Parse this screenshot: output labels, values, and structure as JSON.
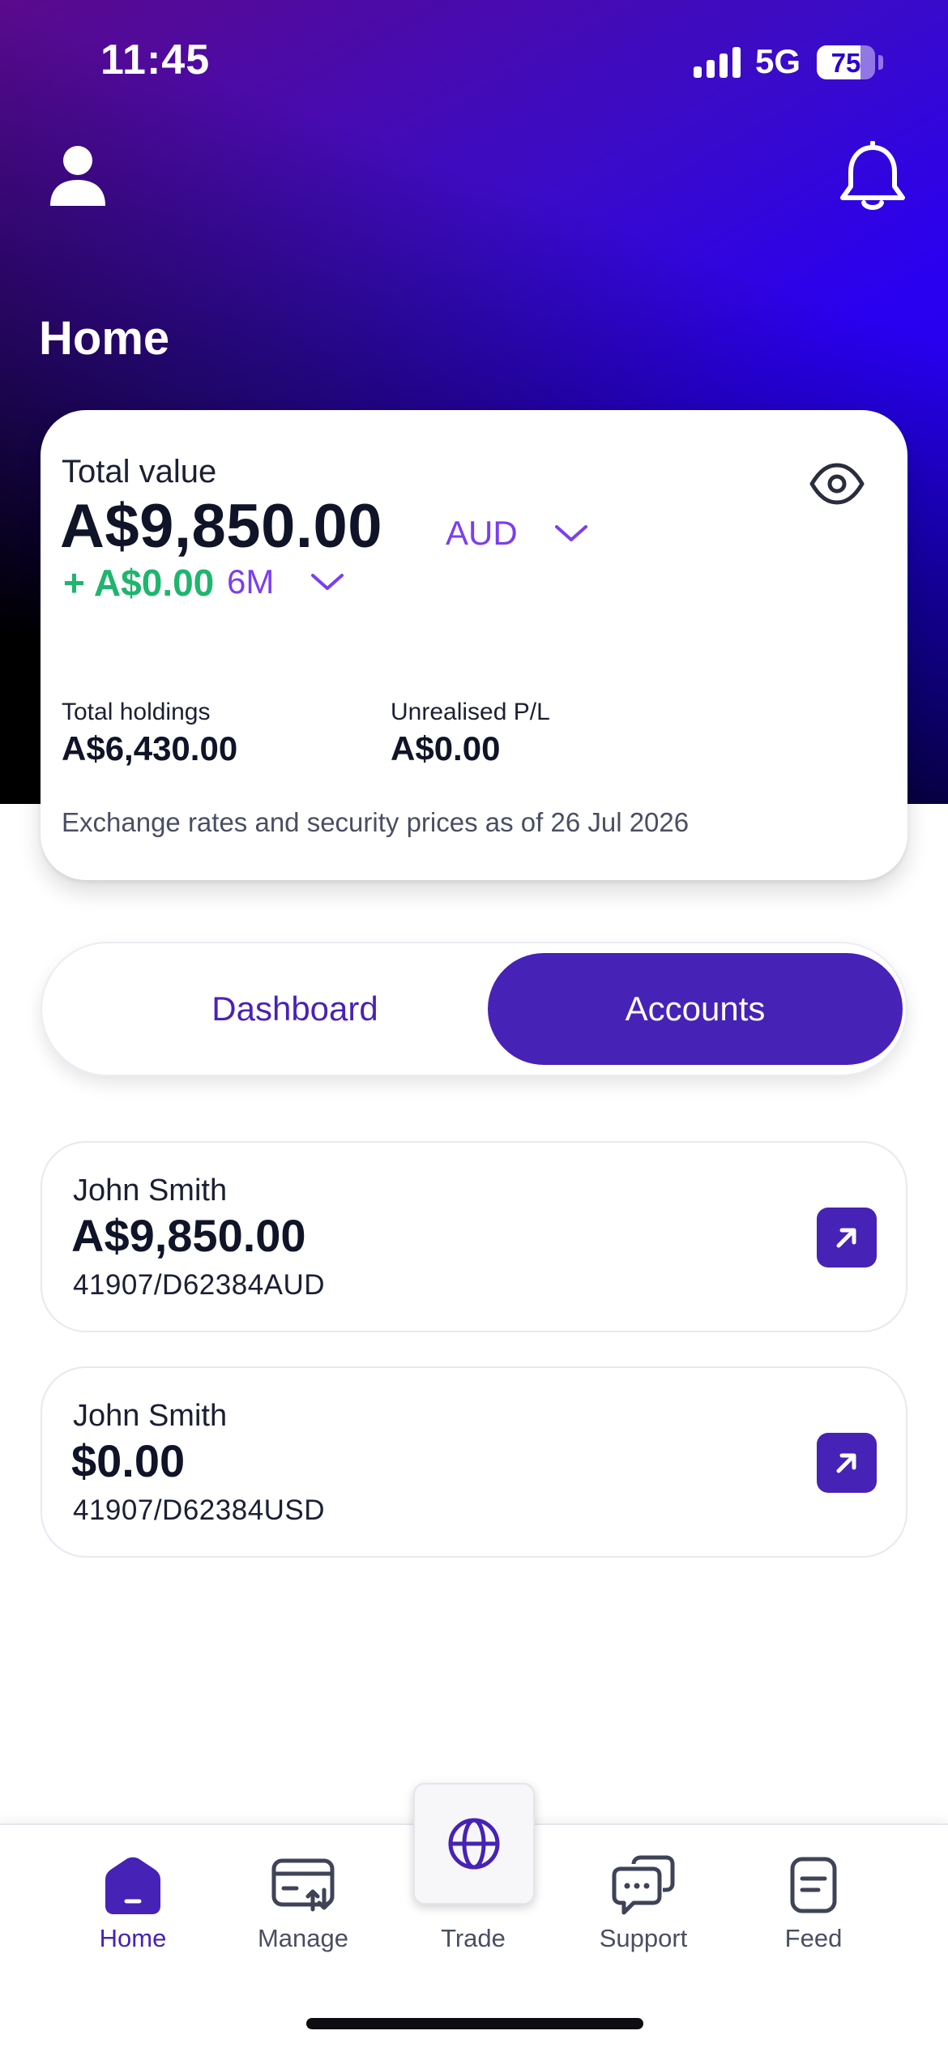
{
  "status_bar": {
    "time": "11:45",
    "network": "5G",
    "battery": "75",
    "battery_level": 0.75
  },
  "header": {
    "title": "Home",
    "profile_icon": "person-icon",
    "notification_icon": "bell-icon"
  },
  "summary": {
    "total_value_label": "Total value",
    "total_value": "A$9,850.00",
    "currency": "AUD",
    "change_value": "+ A$0.00",
    "period": "6M",
    "visibility_icon": "eye-icon",
    "total_holdings_label": "Total holdings",
    "total_holdings": "A$6,430.00",
    "unrealised_label": "Unrealised P/L",
    "unrealised_value": "A$0.00",
    "rates_note": "Exchange rates and security prices as of 26 Jul 2026"
  },
  "segments": {
    "dashboard_label": "Dashboard",
    "accounts_label": "Accounts",
    "selected": "Accounts"
  },
  "accounts": [
    {
      "name": "John Smith",
      "balance": "A$9,850.00",
      "number": "41907/D62384AUD"
    },
    {
      "name": "John Smith",
      "balance": "$0.00",
      "number": "41907/D62384USD"
    }
  ],
  "tab_bar": {
    "home": "Home",
    "manage": "Manage",
    "trade": "Trade",
    "support": "Support",
    "feed": "Feed",
    "active": "Home"
  },
  "colors": {
    "accent": "#4622b6",
    "accent_light": "#7b3ef0",
    "positive": "#1fb56e",
    "header_gradient_start": "#5a0a8c",
    "header_gradient_end": "#1800e6"
  }
}
